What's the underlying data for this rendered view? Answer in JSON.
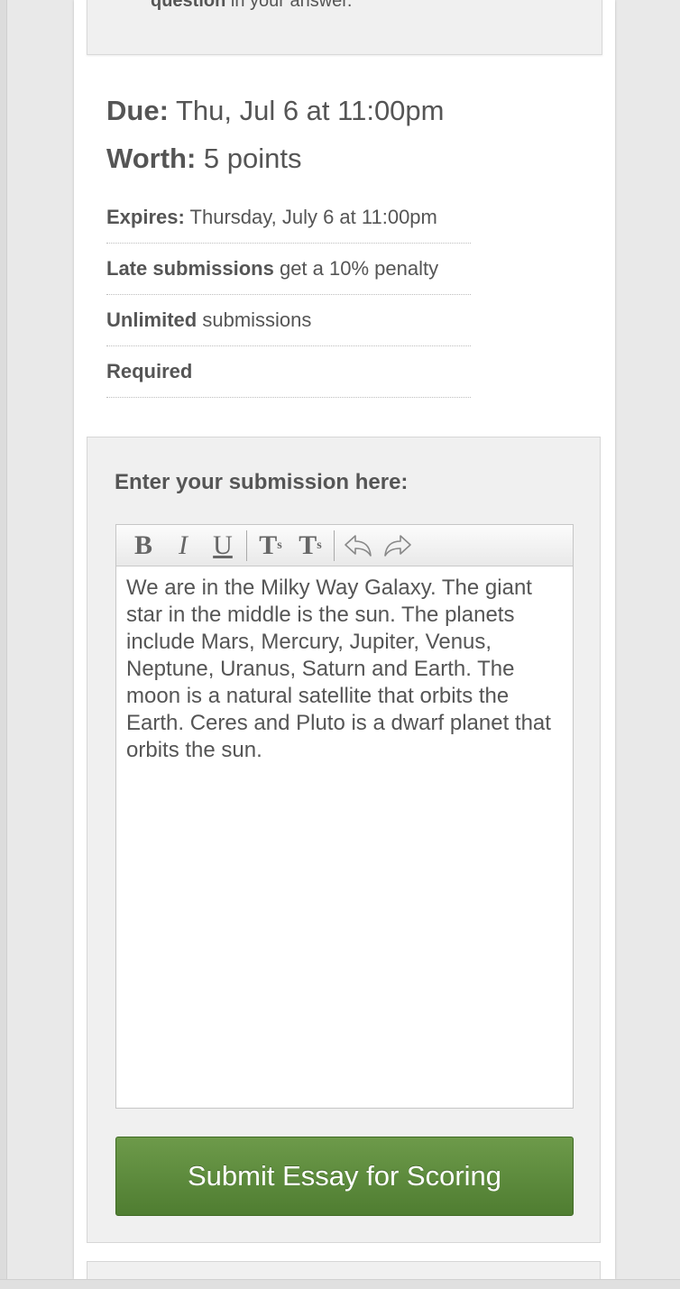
{
  "top_box": {
    "bold_text": "question",
    "rest_text": " in your answer."
  },
  "assignment": {
    "due_label": "Due:",
    "due_value": " Thu, Jul 6 at 11:00pm",
    "worth_label": "Worth:",
    "worth_value": " 5 points"
  },
  "meta": [
    {
      "bold": "Expires:",
      "text": " Thursday, July 6 at 11:00pm"
    },
    {
      "bold": "Late submissions",
      "text": " get a 10% penalty"
    },
    {
      "bold": "Unlimited",
      "text": " submissions"
    },
    {
      "bold": "Required",
      "text": ""
    }
  ],
  "submission": {
    "heading": "Enter your submission here:",
    "toolbar": {
      "bold": "B",
      "italic": "I",
      "underline": "U",
      "subscript_base": "T",
      "subscript_mark": "s",
      "superscript_base": "T",
      "superscript_mark": "s",
      "undo_icon": "undo-arrow",
      "redo_icon": "redo-arrow"
    },
    "essay_text": "We are in the Milky Way Galaxy. The giant star in the middle is the sun. The planets include Mars, Mercury, Jupiter, Venus, Neptune, Uranus, Saturn and Earth. The moon is a natural satellite that orbits the Earth. Ceres and Pluto is a dwarf planet that orbits the sun.",
    "submit_label": "Submit Essay for Scoring",
    "submit_color": "#5f8c3e"
  }
}
